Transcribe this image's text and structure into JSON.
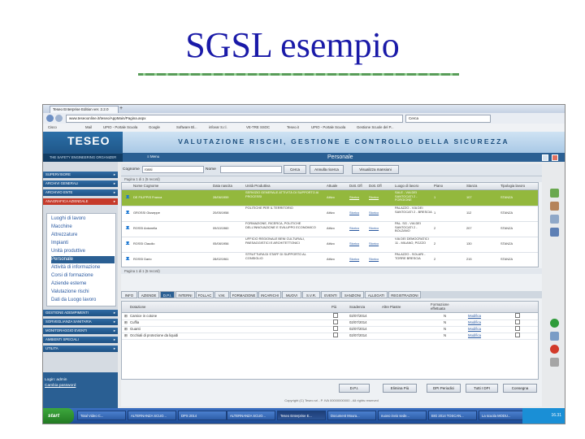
{
  "slide": {
    "title": "SGSL esempio"
  },
  "browser": {
    "tab_title": "Teseo Enterprise Edition ver. 2.2.0",
    "url": "www.teseoonline.it/teseo/AppMain/Pagina.aspx",
    "search_placeholder": "Cerca",
    "bookmarks": [
      "Cisco",
      "Mail",
      "UPIO - Portale Scuola",
      "Google",
      "Software Bl...",
      "infovar S.r.l.",
      "VE-TRE SSOC",
      "Teseo.it",
      "UPIO - Portale Scuola",
      "Gestione Scuole del P..."
    ]
  },
  "app": {
    "logo": "TESEO",
    "logo_sub": "THE SAFETY ENGINEERING ORGANIZER",
    "banner": "VALUTAZIONE RISCHI, GESTIONE E CONTROLLO DELLA SICUREZZA",
    "section_title": "Personale",
    "menu_label": "Menu"
  },
  "sidebar": {
    "groups_top": [
      "SUPERVISORE",
      "ARCHIVI GENERALI",
      "ARCHIVIO ENTE",
      "ANAGRAFICA AZIENDALE"
    ],
    "submenu": [
      "Luoghi di lavoro",
      "Macchine",
      "Attrezzature",
      "Impianti",
      "Unità produttive",
      "Personale",
      "Attività di informazione",
      "Corsi di formazione",
      "Aziende esterne",
      "Valutazione rischi",
      "Dati da Luogo lavoro"
    ],
    "selected_index": 5,
    "groups_bottom": [
      "GESTIONE ADEMPIMENTI",
      "SORVEGLIANZA SANITARIA",
      "MONITORAGGIO EVENTI",
      "AMBIENTI SPECIALI",
      "UTILITA"
    ],
    "user": {
      "label": "Login: admin",
      "link": "Cambia password"
    }
  },
  "search": {
    "cognome_label": "Cognome",
    "cognome_value": "rossi",
    "nome_label": "Nome",
    "cerca": "Cerca",
    "annulla": "Annulla ricerca",
    "visualizza": "Visualizza mansioni"
  },
  "pager_top": "Pagina 1 di 1 (5 record)",
  "grid": {
    "columns": [
      "Nome Cognome",
      "Data nascita",
      "Unità Produttiva",
      "Attuale",
      "Dott. Dfl",
      "Dott. Dfl",
      "Luogo di lavoro",
      "Piano",
      "Stanza",
      "Tipologia lavoro"
    ],
    "rows": [
      [
        "DE FILIPPIS Franca",
        "28/06/1959",
        "SERVIZIO GENERALE ATTIVITÀ DI SUPPORTO AI PROCESSI",
        "Attivo",
        "Storico",
        "Storico",
        "SALE - VIA DEI SANTOCATI 2 - FORGIONE",
        "1",
        "107",
        "STANZA"
      ],
      [
        "GROSSI Giuseppe",
        "20/05/1958",
        "POLITICHE PER IL TERRITORIO",
        "Attivo",
        "Storico",
        "Storico",
        "PALAZZO - VIA DEI SANTOCATI 2 - BRESCIA",
        "1",
        "112",
        "STANZA"
      ],
      [
        "ROSSI Antonella",
        "09/10/1960",
        "FORMAZIONE, RICERCA, POLITICHE DELL'INNOVAZIONE E SVILUPPO ECONOMICO",
        "Attivo",
        "Storico",
        "Storico",
        "PAL. SG - VIA DEI SANTOCATI 2 - BOLZANO",
        "2",
        "207",
        "STANZA"
      ],
      [
        "ROSSI Claudio",
        "05/08/1956",
        "UFFICIO REGIONALE BENI CULTURALI, PAESAGGISTICI E ARCHITETTONICI",
        "Attivo",
        "Storico",
        "Storico",
        "VIA DEI DEMOCRATICI 11 - MILANO, POZZO",
        "2",
        "130",
        "STANZA"
      ],
      [
        "ROSSI Dario",
        "28/02/1961",
        "STRUTTURA DI STAFF DI SUPPORTO AL CONSIGLIO",
        "Attivo",
        "Storico",
        "Storico",
        "PALAZZO - SOLARI - TORRE BRESCIA",
        "2",
        "215",
        "STANZA"
      ]
    ],
    "selected_row": 0
  },
  "pager_bottom": "Pagina 1 di 1 (5 record)",
  "tabs": [
    "INFO",
    "AZIENDE",
    "D.P.I.",
    "INTERNI",
    "FOLLAC",
    "V.M.",
    "FORMAZIONE",
    "INCARICHI",
    "MUOVI",
    "S.V.R.",
    "EVENTI",
    "SANZIONI",
    "ALLEGATI",
    "REGISTRAZIONI"
  ],
  "active_tab": 2,
  "grid2": {
    "columns": [
      "Dotazione",
      "Più",
      "Scadenza",
      "Altre Piastre",
      "Formazione effettuata",
      "",
      ""
    ],
    "rows": [
      [
        "Camice in cotone",
        "02/07/2014",
        "N",
        "Modifica"
      ],
      [
        "Cuffia",
        "02/07/2014",
        "N",
        "Modifica"
      ],
      [
        "Guanti",
        "02/07/2014",
        "N",
        "Modifica"
      ],
      [
        "Occhiali di protezione da liquidi",
        "02/07/2014",
        "N",
        "Modifica"
      ]
    ]
  },
  "actions": [
    "D.P.I.",
    "Elimina Più",
    "DPI Periodici",
    "Tutti I DPI",
    "Consegna"
  ],
  "footer": "Copyright (C) Teseo srl - P. IVA 00000000000 - All rights reserved",
  "taskbar": {
    "start": "start",
    "tasks": [
      "Total Video C...",
      "ALTERNANZA SCUO...",
      "DPS 2014",
      "ALTERNANZA SCUO...",
      "Teseo Enterprise E...",
      "Document Moura...",
      "nuovo invio sede...",
      "BIG 2014 TOSCAN...",
      "La scuola MODU..."
    ],
    "active_task": 4,
    "clock": "16.31"
  }
}
